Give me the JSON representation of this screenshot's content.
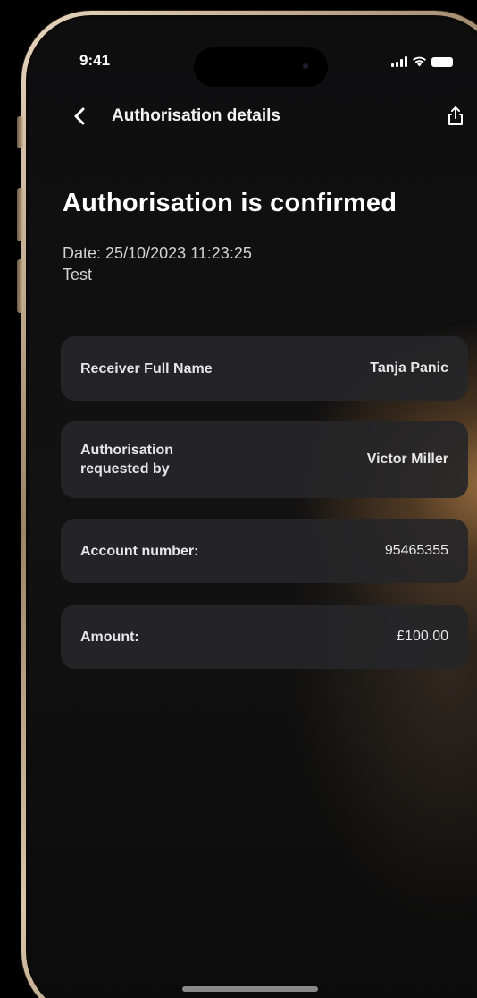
{
  "status_bar": {
    "time": "9:41",
    "icons": [
      "signal-icon",
      "wifi-icon",
      "battery-icon"
    ]
  },
  "nav": {
    "back_icon": "chevron-left-icon",
    "title": "Authorisation details",
    "share_icon": "share-icon"
  },
  "header": {
    "title": "Authorisation is confirmed",
    "date": "Date: 25/10/2023 11:23:25",
    "subtitle": "Test"
  },
  "details": [
    {
      "label": "Receiver Full Name",
      "value": "Tanja Panic"
    },
    {
      "label": "Authorisation requested by",
      "value": "Victor Miller"
    },
    {
      "label": "Account number:",
      "value": "95465355"
    },
    {
      "label": "Amount:",
      "value": "£100.00"
    }
  ],
  "colors": {
    "background": "#000000",
    "screen": "#111111",
    "card": "#262628",
    "text": "#ffffff",
    "accent_glow": "#b07e48",
    "frame": "#c9b08f"
  }
}
